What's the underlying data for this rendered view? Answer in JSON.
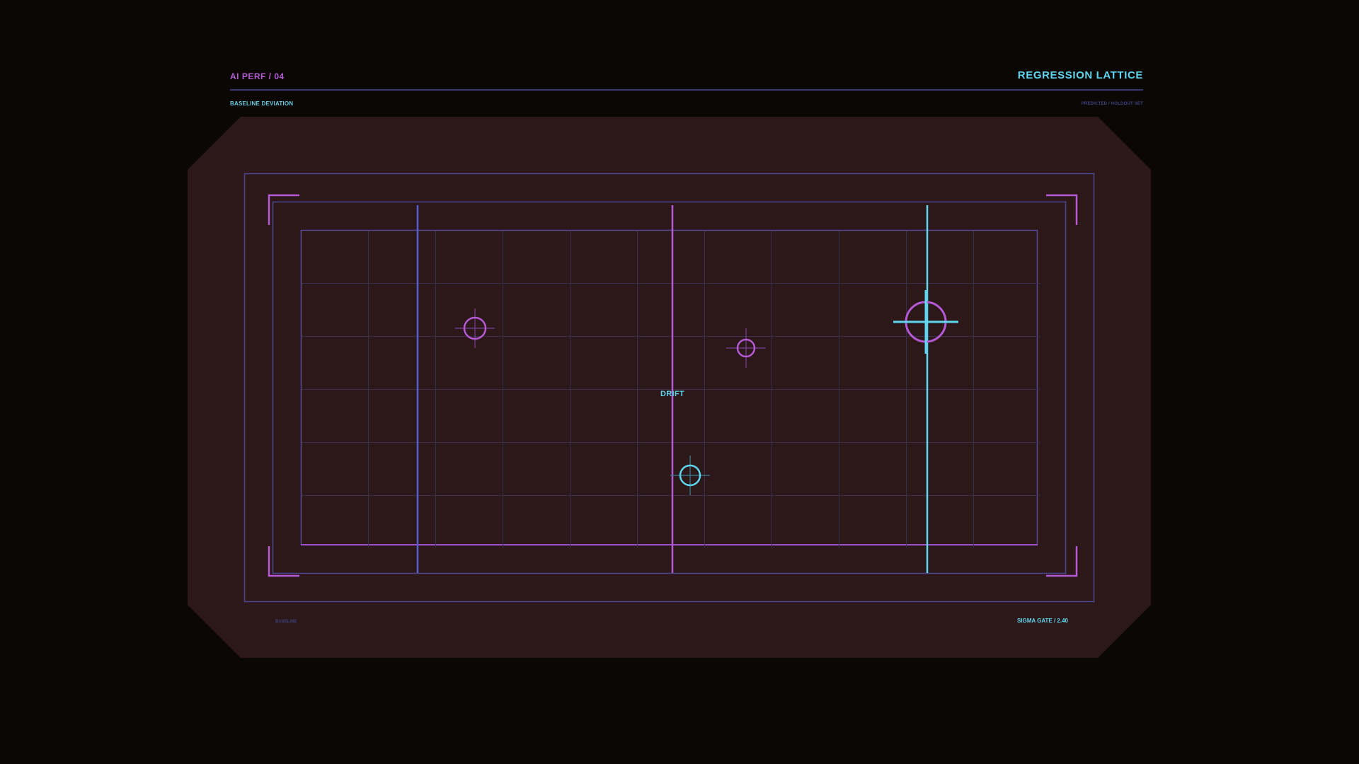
{
  "header": {
    "left_label": "AI PERF / 04",
    "title": "REGRESSION LATTICE",
    "subtitle_left": "BASELINE DEVIATION",
    "subtitle_right": "PREDICTED / HOLDOUT SET"
  },
  "lattice": {
    "center_label": "DRIFT",
    "footer_left": "BASELINE",
    "footer_right": "SIGMA GATE / 2.40"
  },
  "colors": {
    "background": "#0b0705",
    "panel": "#2d1819",
    "violet": "#b55ad6",
    "cyan": "#5fd6ef",
    "indigo": "#5560d0",
    "frame": "#4a4690",
    "grid": "#3c2e4e"
  }
}
